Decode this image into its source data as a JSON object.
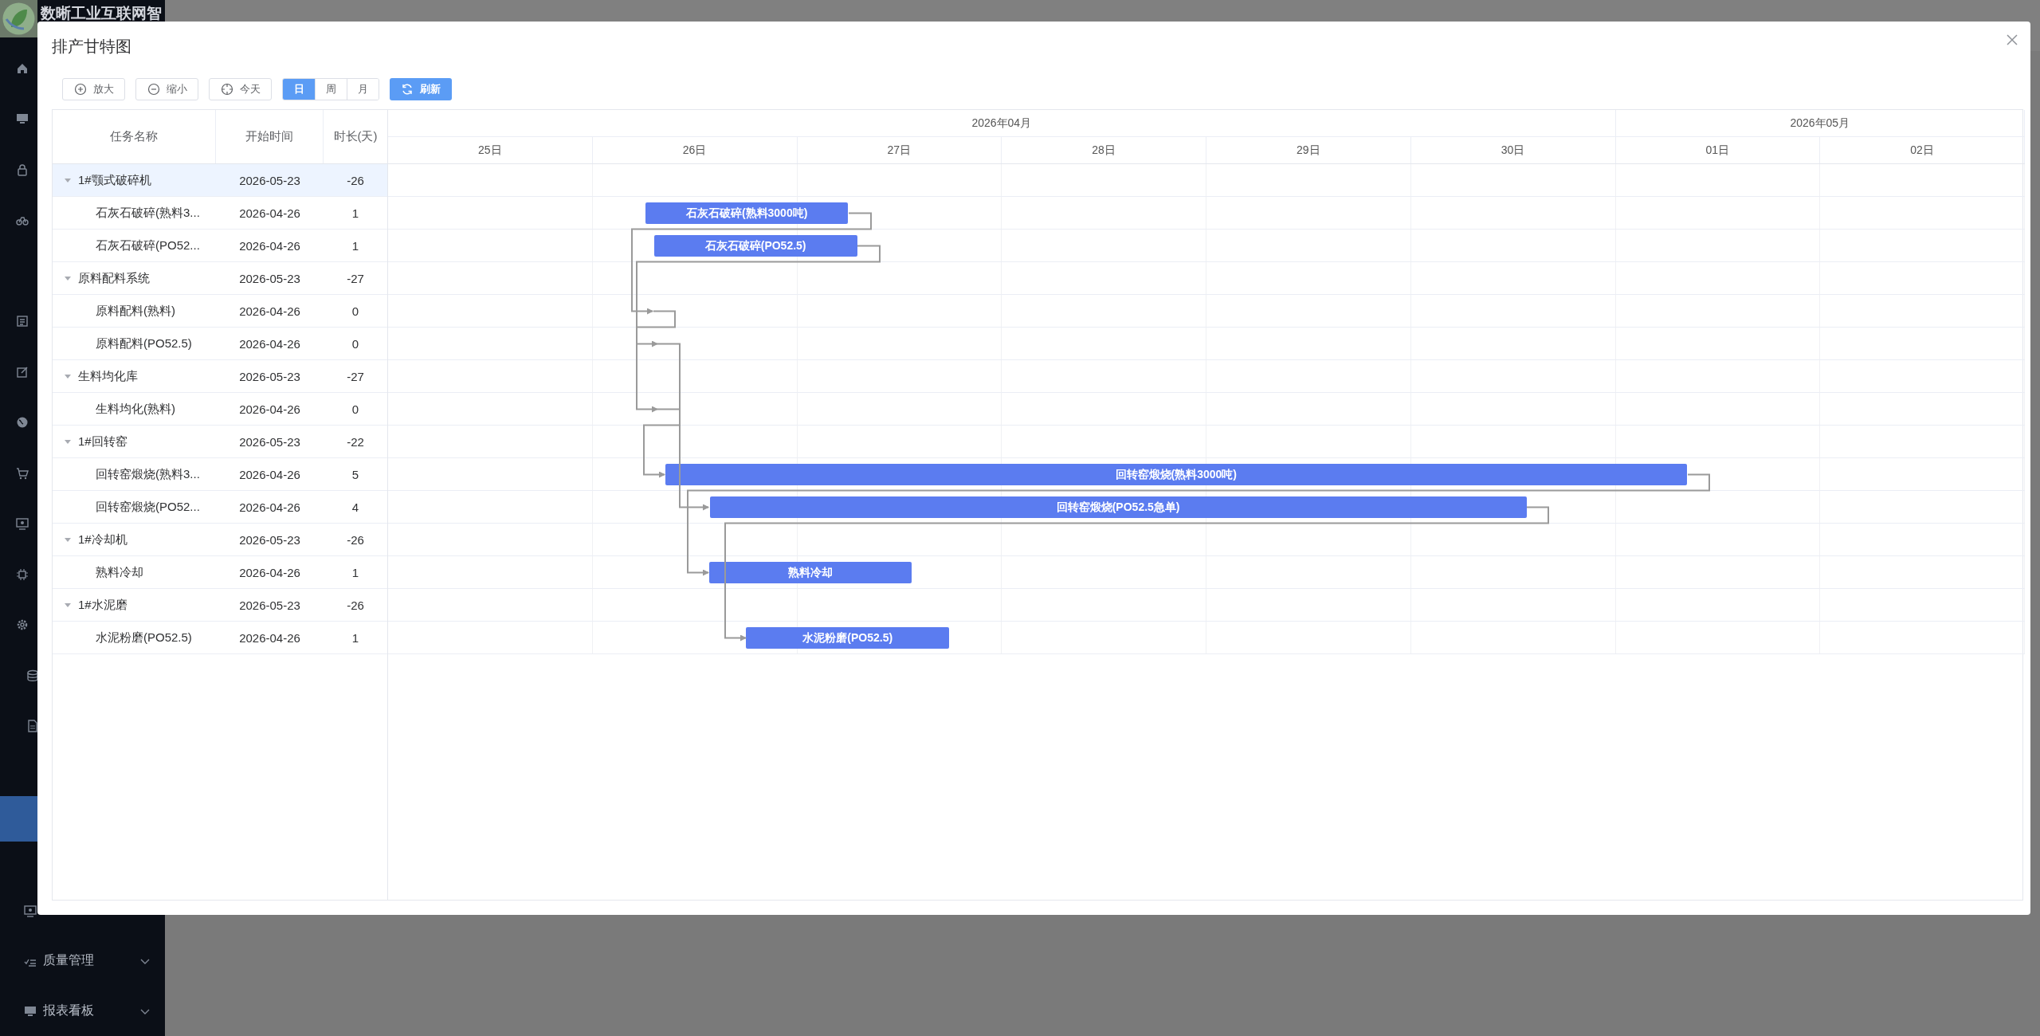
{
  "app": {
    "brand": "数晰工业互联网智",
    "sidebar_bottom": [
      {
        "label": "质量管理",
        "expanded": false
      },
      {
        "label": "报表看板",
        "expanded": false
      }
    ]
  },
  "dialog": {
    "title": "排产甘特图",
    "toolbar": {
      "buttons": [
        {
          "label": "放大",
          "kind": "zoom-in"
        },
        {
          "label": "缩小",
          "kind": "zoom-out"
        },
        {
          "label": "今天",
          "kind": "today"
        }
      ],
      "view_modes": [
        {
          "label": "日",
          "selected": true
        },
        {
          "label": "周",
          "selected": false
        },
        {
          "label": "月",
          "selected": false
        }
      ],
      "refresh": {
        "label": "刷新"
      }
    },
    "table": {
      "columns": [
        "任务名称",
        "开始时间",
        "时长(天)"
      ],
      "rows": [
        {
          "name": "1#颚式破碎机",
          "start": "2026-05-23",
          "duration": "-26",
          "expanded": true,
          "selected": true,
          "children": [
            {
              "name": "石灰石破碎(熟料3...",
              "start": "2026-04-26",
              "duration": "1",
              "selected": false,
              "bar": "石灰石破碎(熟料3000吨)"
            },
            {
              "name": "石灰石破碎(PO52...",
              "start": "2026-04-26",
              "duration": "1",
              "selected": false,
              "bar": "石灰石破碎(PO52.5)"
            }
          ]
        },
        {
          "name": "原料配料系统",
          "start": "2026-05-23",
          "duration": "-27",
          "expanded": true,
          "selected": false,
          "children": [
            {
              "name": "原料配料(熟料)",
              "start": "2026-04-26",
              "duration": "0",
              "selected": false
            },
            {
              "name": "原料配料(PO52.5)",
              "start": "2026-04-26",
              "duration": "0",
              "selected": false
            }
          ]
        },
        {
          "name": "生料均化库",
          "start": "2026-05-23",
          "duration": "-27",
          "expanded": true,
          "selected": false,
          "children": [
            {
              "name": "生料均化(熟料)",
              "start": "2026-04-26",
              "duration": "0",
              "selected": false
            }
          ]
        },
        {
          "name": "1#回转窑",
          "start": "2026-05-23",
          "duration": "-22",
          "expanded": true,
          "selected": false,
          "children": [
            {
              "name": "回转窑煅烧(熟料3...",
              "start": "2026-04-26",
              "duration": "5",
              "selected": false,
              "bar": "回转窑煅烧(熟料3000吨)"
            },
            {
              "name": "回转窑煅烧(PO52...",
              "start": "2026-04-26",
              "duration": "4",
              "selected": false,
              "bar": "回转窑煅烧(PO52.5急单)"
            }
          ]
        },
        {
          "name": "1#冷却机",
          "start": "2026-05-23",
          "duration": "-26",
          "expanded": true,
          "selected": false,
          "children": [
            {
              "name": "熟料冷却",
              "start": "2026-04-26",
              "duration": "1",
              "selected": false,
              "bar": "熟料冷却"
            }
          ]
        },
        {
          "name": "1#水泥磨",
          "start": "2026-05-23",
          "duration": "-26",
          "expanded": true,
          "selected": false,
          "children": [
            {
              "name": "水泥粉磨(PO52.5)",
              "start": "2026-04-26",
              "duration": "1",
              "selected": false,
              "bar": "水泥粉磨(PO52.5)"
            }
          ]
        }
      ]
    },
    "timeline": {
      "months": [
        {
          "label": "2026年04月",
          "days": [
            "25日",
            "26日",
            "27日",
            "28日",
            "29日",
            "30日"
          ]
        },
        {
          "label": "2026年05月",
          "days": [
            "01日",
            "02日"
          ]
        }
      ]
    }
  }
}
